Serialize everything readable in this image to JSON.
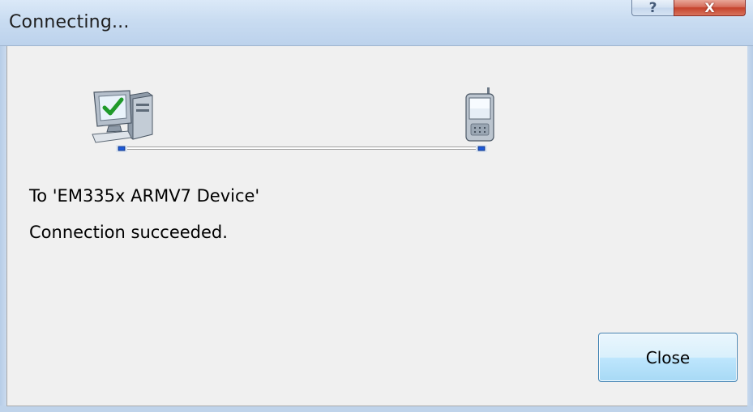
{
  "window": {
    "title": "Connecting...",
    "help_glyph": "?",
    "close_glyph": "X"
  },
  "connection": {
    "from_icon": "desktop-computer-check-icon",
    "to_icon": "pda-device-icon"
  },
  "messages": {
    "target": "To 'EM335x ARMV7 Device'",
    "status": "Connection succeeded."
  },
  "buttons": {
    "close_label": "Close"
  },
  "colors": {
    "titlebar": "#c9dcf1",
    "client_bg": "#f0f0f0",
    "close_caption": "#c5422c",
    "button_border": "#3c7fb1"
  }
}
